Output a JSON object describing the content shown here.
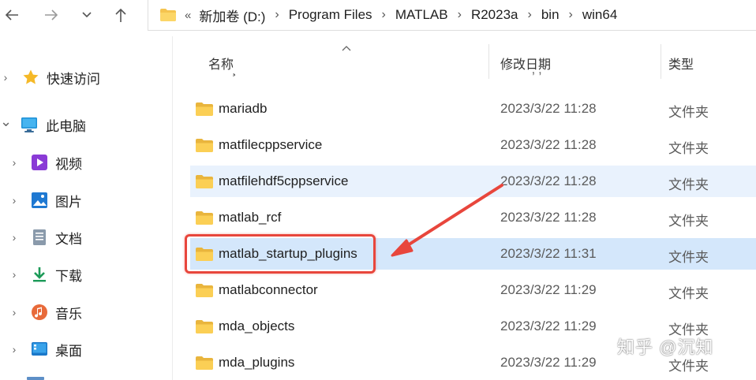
{
  "navigation": {
    "back_icon": "arrow-left-icon",
    "forward_icon": "arrow-right-icon",
    "history_icon": "chevron-down-icon",
    "up_icon": "arrow-up-icon"
  },
  "address_bar": {
    "overflow": "«",
    "crumbs": [
      "新加卷 (D:)",
      "Program Files",
      "MATLAB",
      "R2023a",
      "bin",
      "win64"
    ]
  },
  "sidebar": {
    "items": [
      {
        "label": "快速访问",
        "icon": "star-icon",
        "expand": "›"
      },
      {
        "label": "此电脑",
        "icon": "computer-icon",
        "expand": "⌄"
      },
      {
        "label": "视频",
        "icon": "video-icon",
        "expand": "›"
      },
      {
        "label": "图片",
        "icon": "picture-icon",
        "expand": "›"
      },
      {
        "label": "文档",
        "icon": "document-icon",
        "expand": "›"
      },
      {
        "label": "下载",
        "icon": "download-icon",
        "expand": "›"
      },
      {
        "label": "音乐",
        "icon": "music-icon",
        "expand": "›"
      },
      {
        "label": "桌面",
        "icon": "desktop-icon",
        "expand": "›"
      }
    ]
  },
  "columns": {
    "name": "名称",
    "date": "修改日期",
    "type": "类型"
  },
  "files": [
    {
      "name": "mariadb",
      "date": "2023/3/22 11:28",
      "type": "文件夹"
    },
    {
      "name": "matfilecppservice",
      "date": "2023/3/22 11:28",
      "type": "文件夹"
    },
    {
      "name": "matfilehdf5cppservice",
      "date": "2023/3/22 11:28",
      "type": "文件夹"
    },
    {
      "name": "matlab_rcf",
      "date": "2023/3/22 11:28",
      "type": "文件夹"
    },
    {
      "name": "matlab_startup_plugins",
      "date": "2023/3/22 11:31",
      "type": "文件夹"
    },
    {
      "name": "matlabconnector",
      "date": "2023/3/22 11:29",
      "type": "文件夹"
    },
    {
      "name": "mda_objects",
      "date": "2023/3/22 11:29",
      "type": "文件夹"
    },
    {
      "name": "mda_plugins",
      "date": "2023/3/22 11:29",
      "type": "文件夹"
    }
  ],
  "watermark": "知乎 @沉知",
  "colors": {
    "folder": "#f5c44f",
    "annotation": "#e8463c",
    "selection": "#d4e7fb",
    "hover": "#e9f2fd"
  }
}
